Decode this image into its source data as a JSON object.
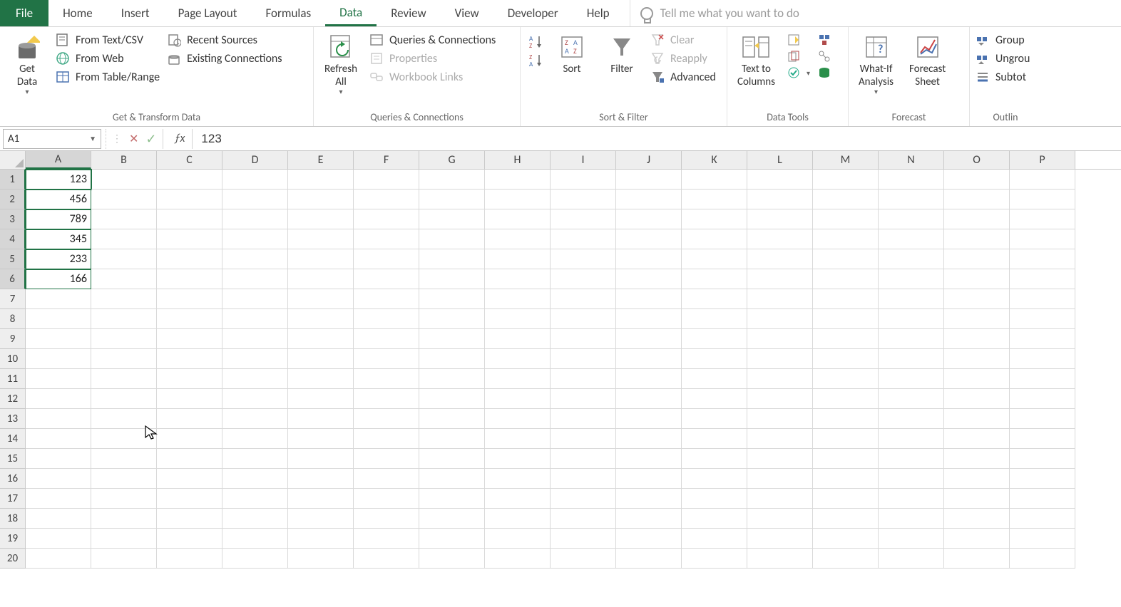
{
  "tabs": {
    "file": "File",
    "items": [
      "Home",
      "Insert",
      "Page Layout",
      "Formulas",
      "Data",
      "Review",
      "View",
      "Developer",
      "Help"
    ],
    "active_index": 4,
    "tell_me_placeholder": "Tell me what you want to do"
  },
  "ribbon": {
    "get_transform": {
      "get_data": "Get\nData",
      "from_text": "From Text/CSV",
      "from_web": "From Web",
      "from_table": "From Table/Range",
      "recent_sources": "Recent Sources",
      "existing_conn": "Existing Connections",
      "label": "Get & Transform Data"
    },
    "queries": {
      "refresh_all": "Refresh\nAll",
      "queries_conn": "Queries & Connections",
      "properties": "Properties",
      "workbook_links": "Workbook Links",
      "label": "Queries & Connections"
    },
    "sort_filter": {
      "sort": "Sort",
      "filter": "Filter",
      "clear": "Clear",
      "reapply": "Reapply",
      "advanced": "Advanced",
      "label": "Sort & Filter"
    },
    "data_tools": {
      "text_to_columns": "Text to\nColumns",
      "label": "Data Tools"
    },
    "forecast": {
      "what_if": "What-If\nAnalysis",
      "forecast_sheet": "Forecast\nSheet",
      "label": "Forecast"
    },
    "outline": {
      "group": "Group",
      "ungroup": "Ungrou",
      "subtotal": "Subtot",
      "label": "Outlin"
    }
  },
  "formula_bar": {
    "name_box": "A1",
    "formula": "123"
  },
  "grid": {
    "columns": [
      "A",
      "B",
      "C",
      "D",
      "E",
      "F",
      "G",
      "H",
      "I",
      "J",
      "K",
      "L",
      "M",
      "N",
      "O",
      "P"
    ],
    "rows": 20,
    "active_cell": {
      "row": 1,
      "col": "A"
    },
    "selected_range_end": {
      "row": 6,
      "col": "A"
    },
    "data": {
      "A1": "123",
      "A2": "456",
      "A3": "789",
      "A4": "345",
      "A5": "233",
      "A6": "166"
    }
  }
}
